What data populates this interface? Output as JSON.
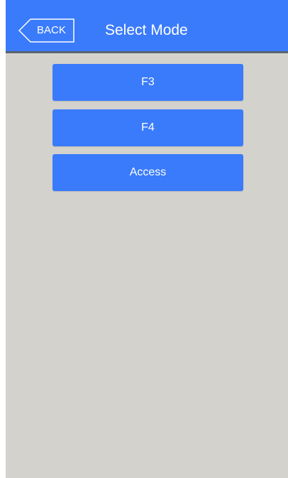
{
  "header": {
    "back_label": "BACK",
    "title": "Select Mode"
  },
  "modes": [
    {
      "label": "F3"
    },
    {
      "label": "F4"
    },
    {
      "label": "Access"
    }
  ],
  "colors": {
    "accent": "#3a7bfb",
    "background": "#d4d2cd",
    "divider": "#5a6272",
    "text_on_accent": "#ffffff"
  }
}
